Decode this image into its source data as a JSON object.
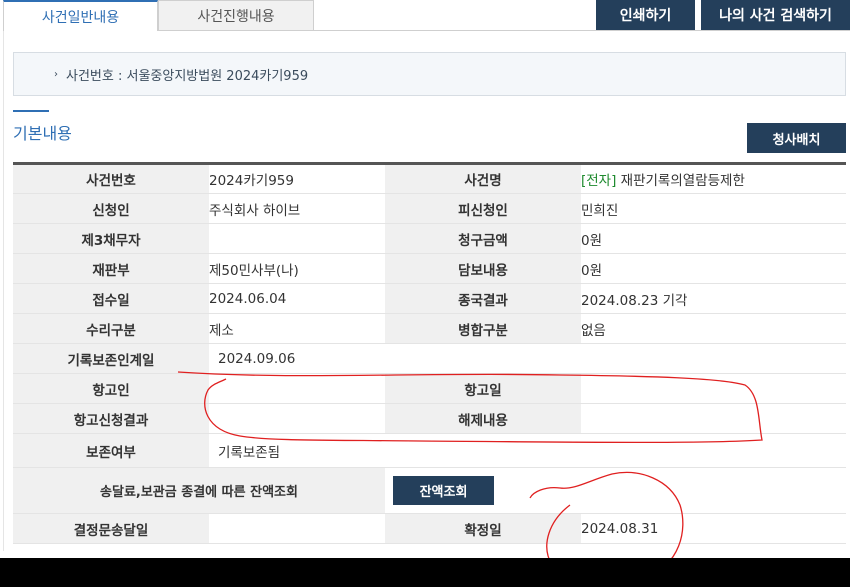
{
  "tabs": {
    "general": "사건일반내용",
    "progress": "사건진행내용"
  },
  "header_buttons": {
    "print": "인쇄하기",
    "my_case_search": "나의 사건 검색하기"
  },
  "case_header": {
    "text": "사건번호 : 서울중앙지방법원 2024카기959"
  },
  "section": {
    "title": "기본내용",
    "office_button": "청사배치"
  },
  "rows": {
    "case_number": {
      "label": "사건번호",
      "value": "2024카기959"
    },
    "case_name": {
      "label": "사건명",
      "tag": "[전자]",
      "value": "재판기록의열람등제한"
    },
    "applicant": {
      "label": "신청인",
      "value": "주식회사 하이브"
    },
    "respondent": {
      "label": "피신청인",
      "value": "민희진"
    },
    "third_debtor": {
      "label": "제3채무자",
      "value": ""
    },
    "claim_amount": {
      "label": "청구금액",
      "value": "0원"
    },
    "court_division": {
      "label": "재판부",
      "value": "제50민사부(나)"
    },
    "security": {
      "label": "담보내용",
      "value": "0원"
    },
    "filed_date": {
      "label": "접수일",
      "value": "2024.06.04"
    },
    "final_result": {
      "label": "종국결과",
      "value": "2024.08.23 기각"
    },
    "receipt_type": {
      "label": "수리구분",
      "value": "제소"
    },
    "merge_type": {
      "label": "병합구분",
      "value": "없음"
    },
    "record_preserve_date": {
      "label": "기록보존인계일",
      "value": "2024.09.06"
    },
    "appellant": {
      "label": "항고인",
      "value": ""
    },
    "appeal_date": {
      "label": "항고일",
      "value": ""
    },
    "appeal_result": {
      "label": "항고신청결과",
      "value": ""
    },
    "release": {
      "label": "해제내용",
      "value": ""
    },
    "preservation": {
      "label": "보존여부",
      "value": "기록보존됨"
    },
    "deposit_balance": {
      "label": "송달료,보관금 종결에 따른 잔액조회",
      "button": "잔액조회"
    },
    "decision_delivery": {
      "label": "결정문송달일",
      "value": ""
    },
    "confirmed_date": {
      "label": "확정일",
      "value": "2024.08.31"
    }
  },
  "colors": {
    "navy_button": "#243f5b",
    "accent_blue": "#2f6fb4",
    "e_tag_green": "#1e8a2e",
    "annotation_red": "#e02020"
  }
}
